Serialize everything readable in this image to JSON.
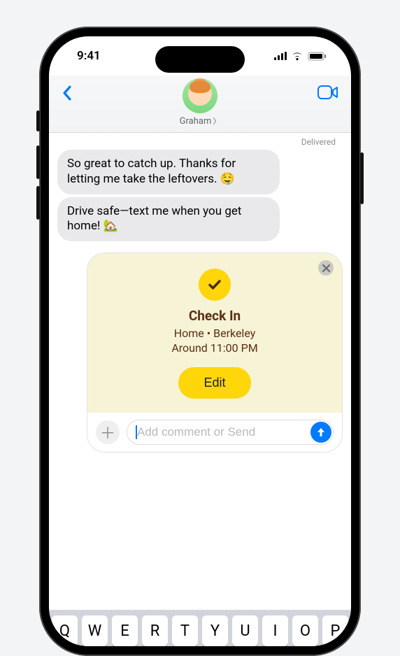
{
  "status": {
    "time": "9:41"
  },
  "header": {
    "contact_name": "Graham"
  },
  "thread": {
    "delivered_label": "Delivered",
    "messages": [
      {
        "text": "So great to catch up. Thanks for letting me take the leftovers. 🤤"
      },
      {
        "text": "Drive safe—text me when you get home! 🏡"
      }
    ]
  },
  "checkin": {
    "title": "Check In",
    "location_line": "Home  •  Berkeley",
    "time_line": "Around 11:00 PM",
    "edit_label": "Edit"
  },
  "compose": {
    "placeholder": "Add comment or Send"
  },
  "keyboard": {
    "row1": [
      "Q",
      "W",
      "E",
      "R",
      "T",
      "Y",
      "U",
      "I",
      "O",
      "P"
    ]
  }
}
